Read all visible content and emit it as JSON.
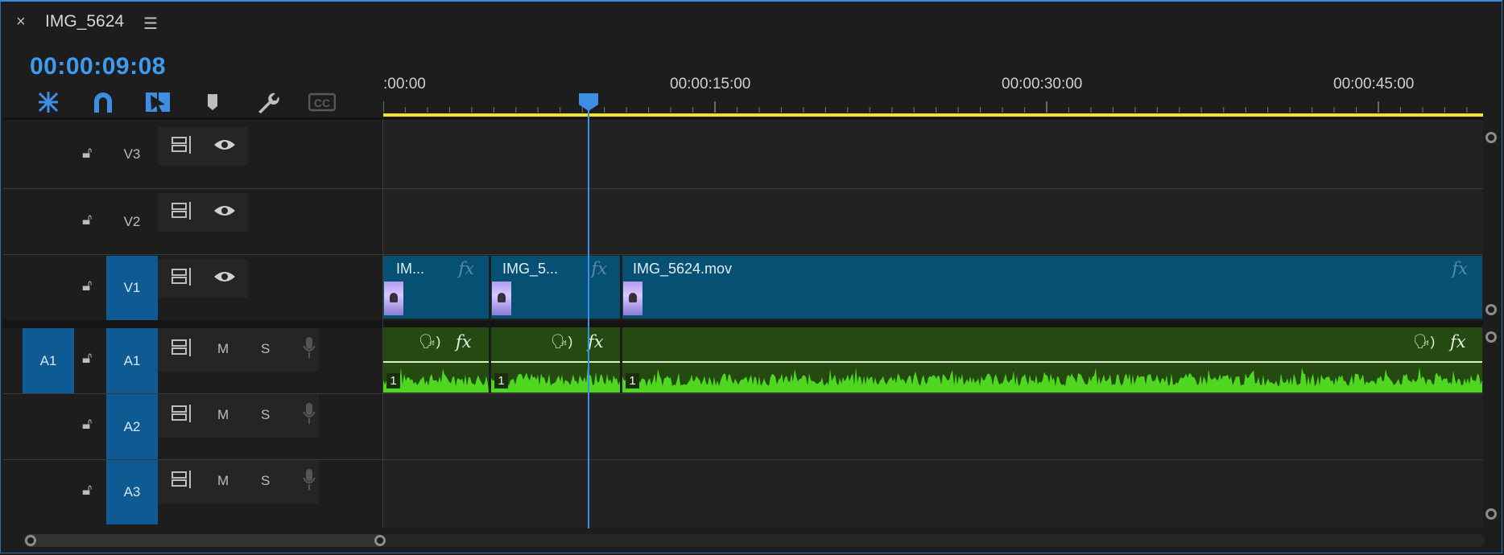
{
  "panel": {
    "close_glyph": "×",
    "title": "IMG_5624",
    "menu_glyph": "☰",
    "timecode": "00:00:09:08"
  },
  "toolbar": {
    "tools": [
      {
        "name": "insert-nest-icon"
      },
      {
        "name": "snap-magnet-icon"
      },
      {
        "name": "linked-selection-icon"
      },
      {
        "name": "add-marker-icon"
      },
      {
        "name": "settings-wrench-icon"
      },
      {
        "name": "captions-icon",
        "label": "CC"
      }
    ]
  },
  "ruler": {
    "labels": [
      ":00:00",
      "00:00:15:00",
      "00:00:30:00",
      "00:00:45:00"
    ],
    "playhead_time": "00:00:09:08"
  },
  "tracks": {
    "video": [
      {
        "name": "V3",
        "targeted": false
      },
      {
        "name": "V2",
        "targeted": false
      },
      {
        "name": "V1",
        "targeted": true
      }
    ],
    "audio": [
      {
        "name": "A1",
        "source_patch": "A1",
        "targeted": true,
        "mute": "M",
        "solo": "S"
      },
      {
        "name": "A2",
        "targeted": true,
        "mute": "M",
        "solo": "S"
      },
      {
        "name": "A3",
        "targeted": true,
        "mute": "M",
        "solo": "S"
      }
    ]
  },
  "clips": {
    "video": [
      {
        "label": "IM...",
        "fx": "fx"
      },
      {
        "label": "IMG_5...",
        "fx": "fx"
      },
      {
        "label": "IMG_5624.mov",
        "fx": "fx"
      }
    ],
    "audio": [
      {
        "channel": "1",
        "fx": "fx"
      },
      {
        "channel": "1",
        "fx": "fx"
      },
      {
        "channel": "1",
        "fx": "fx"
      }
    ]
  },
  "colors": {
    "timecode": "#3d9bf0",
    "video_clip": "#065073",
    "audio_clip": "#244a12",
    "waveform": "#4fd620",
    "work_area": "#f0e431",
    "playhead": "#3d8fe6",
    "track_target": "#0e5a92"
  }
}
